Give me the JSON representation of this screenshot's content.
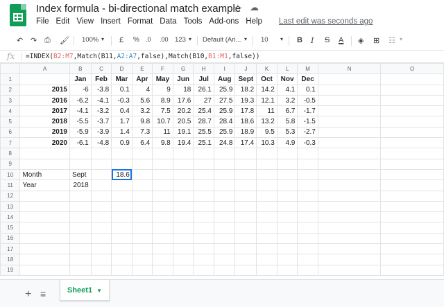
{
  "title": "Index formula - bi-directional match example",
  "menu": [
    "File",
    "Edit",
    "View",
    "Insert",
    "Format",
    "Data",
    "Tools",
    "Add-ons",
    "Help"
  ],
  "last_edit": "Last edit was seconds ago",
  "toolbar": {
    "zoom": "100%",
    "currency": "£",
    "percent": "%",
    "dec_less": ".0",
    "dec_more": ".00",
    "format": "123",
    "font": "Default (Ari...",
    "font_size": "10",
    "bold": "B",
    "italic": "I",
    "strike": "S",
    "text_color": "A"
  },
  "formula": {
    "fx": "fx",
    "p1": "=INDEX(",
    "r1": "B2:M7",
    "p2": ",Match(B11,",
    "r2": "A2:A7",
    "p3": ",false),Match(B10,",
    "r3": "B1:M1",
    "p4": ",false))"
  },
  "columns": [
    "A",
    "B",
    "C",
    "D",
    "E",
    "F",
    "G",
    "H",
    "I",
    "J",
    "K",
    "L",
    "M",
    "N",
    "O"
  ],
  "header_row": [
    "",
    "Jan",
    "Feb",
    "Mar",
    "Apr",
    "May",
    "Jun",
    "Jul",
    "Aug",
    "Sept",
    "Oct",
    "Nov",
    "Dec"
  ],
  "data_rows": [
    {
      "year": "2015",
      "values": [
        "-6",
        "-3.8",
        "0.1",
        "4",
        "9",
        "18",
        "26.1",
        "25.9",
        "18.2",
        "14.2",
        "4.1",
        "0.1"
      ]
    },
    {
      "year": "2016",
      "values": [
        "-6.2",
        "-4.1",
        "-0.3",
        "5.6",
        "8.9",
        "17.6",
        "27",
        "27.5",
        "19.3",
        "12.1",
        "3.2",
        "-0.5"
      ]
    },
    {
      "year": "2017",
      "values": [
        "-4.1",
        "-3.2",
        "0.4",
        "3.2",
        "7.5",
        "20.2",
        "25.4",
        "25.9",
        "17.8",
        "11",
        "6.7",
        "-1.7"
      ]
    },
    {
      "year": "2018",
      "values": [
        "-5.5",
        "-3.7",
        "1.7",
        "9.8",
        "10.7",
        "20.5",
        "28.7",
        "28.4",
        "18.6",
        "13.2",
        "5.8",
        "-1.5"
      ]
    },
    {
      "year": "2019",
      "values": [
        "-5.9",
        "-3.9",
        "1.4",
        "7.3",
        "11",
        "19.1",
        "25.5",
        "25.9",
        "18.9",
        "9.5",
        "5.3",
        "-2.7"
      ]
    },
    {
      "year": "2020",
      "values": [
        "-6.1",
        "-4.8",
        "0.9",
        "6.4",
        "9.8",
        "19.4",
        "25.1",
        "24.8",
        "17.4",
        "10.3",
        "4.9",
        "-0.3"
      ]
    }
  ],
  "lookup": {
    "month_label": "Month",
    "month_value": "Sept",
    "year_label": "Year",
    "year_value": "2018",
    "result": "18.6"
  },
  "row_numbers": [
    "1",
    "2",
    "3",
    "4",
    "5",
    "6",
    "7",
    "8",
    "9",
    "10",
    "11",
    "12",
    "13",
    "14",
    "15",
    "16",
    "17",
    "18",
    "19"
  ],
  "sheet_tab": "Sheet1",
  "colors": {
    "accent": "#1a73e8",
    "sheets_green": "#0f9d58"
  }
}
